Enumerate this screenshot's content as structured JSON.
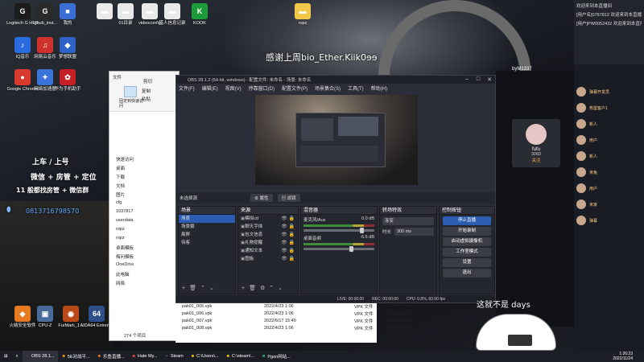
{
  "desktop": {
    "icons": [
      {
        "label": "Logitech G HUB",
        "color": "#1b1b1b",
        "glyph": "G"
      },
      {
        "label": "Ighub_inst...",
        "color": "#2a2a2a",
        "glyph": "G"
      },
      {
        "label": "我的",
        "color": "#3b6fd6",
        "glyph": "■"
      },
      {
        "label": "",
        "color": "#e9e9e9",
        "glyph": "▬"
      },
      {
        "label": "01目录",
        "color": "#e9e9e9",
        "glyph": "▬"
      },
      {
        "label": "videoconfig",
        "color": "#e9e9e9",
        "glyph": "▬"
      },
      {
        "label": "猎人信息记录",
        "color": "#e9e9e9",
        "glyph": "▬"
      },
      {
        "label": "KOOK",
        "color": "#1d9b3a",
        "glyph": "K"
      },
      {
        "label": "ropz",
        "color": "#f2c84b",
        "glyph": "▬"
      },
      {
        "label": "IQ音乐",
        "color": "#2b6be0",
        "glyph": "♪"
      },
      {
        "label": "网易云音乐",
        "color": "#d0312d",
        "glyph": "♫"
      },
      {
        "label": "梦想联盟",
        "color": "#2e62c6",
        "glyph": "◆"
      },
      {
        "label": "Google Chrome",
        "color": "#d93a2f",
        "glyph": "●"
      },
      {
        "label": "网络加速器",
        "color": "#3a74d8",
        "glyph": "✦"
      },
      {
        "label": "华为手机助手",
        "color": "#c61f26",
        "glyph": "✿"
      },
      {
        "label": "火绒安全软件",
        "color": "#e57a21",
        "glyph": "◆"
      },
      {
        "label": "CPU-Z",
        "color": "#4a6a9a",
        "glyph": "▣"
      },
      {
        "label": "FurMark_1...",
        "color": "#b84a1a",
        "glyph": "◉"
      },
      {
        "label": "AIDA64 Extreme",
        "color": "#2f4f8a",
        "glyph": "64"
      },
      {
        "label": "此电脑",
        "color": "#3c7ed1",
        "glyph": "▭"
      },
      {
        "label": "ropz",
        "color": "#f2c84b",
        "glyph": "▬"
      },
      {
        "label": "卡点视频截图",
        "color": "#e0c45a",
        "glyph": "▬"
      },
      {
        "label": "卡点视频截图",
        "color": "#e9e9e9",
        "glyph": "▬"
      },
      {
        "label": "GameBuff",
        "color": "#c35a1a",
        "glyph": "◆"
      },
      {
        "label": "新建文本文档",
        "color": "#e9e9e9",
        "glyph": "▬"
      },
      {
        "label": "KaiHeiLa",
        "color": "#e9e9e9",
        "glyph": "▬"
      },
      {
        "label": "开播",
        "color": "#e9e9e9",
        "glyph": "▬"
      }
    ]
  },
  "overlay": {
    "thanks_text": "感谢上周bio_Ether.Kiik0ɘɘ",
    "promo_line1": "上车 / 上号",
    "promo_line2": "微信 + 房管 + 定位",
    "promo_line3": "11 般都找房管 + 微信群",
    "qq_number": "0813716798570",
    "caption": "这就不是 days"
  },
  "explorer": {
    "ribbon_items": [
      "文件",
      "固定到快速访问",
      "复制",
      "粘贴",
      "剪切"
    ],
    "nav": [
      "快速访问",
      "桌面",
      "下载",
      "文档",
      "图片",
      "cfg",
      "1037817",
      "userdata",
      "ropz",
      "ropz",
      "卓面模板",
      "梅问模板",
      "OneDrive",
      "此电脑",
      "网络"
    ],
    "status": "274 个项目"
  },
  "files": {
    "rows": [
      {
        "name": "pak01_005.vpk",
        "date": "2022/4/23 1:06",
        "type": "VPK 文件",
        "size": "107,540 KB"
      },
      {
        "name": "pak01_006.vpk",
        "date": "2022/4/23 1:06",
        "type": "VPK 文件",
        "size": "130,506 KB"
      },
      {
        "name": "pak01_007.vpk",
        "date": "2022/6/17 15:40",
        "type": "VPK 文件",
        "size": "141,644 KB"
      },
      {
        "name": "pak01_008.vpk",
        "date": "2022/4/23 1:06",
        "type": "VPK 文件",
        "size": "139,020 KB"
      }
    ]
  },
  "obs": {
    "title": "OBS 28.1.2 (64-bit, windows) - 配置文件: 未命名 - 场景: 未命名",
    "menu": [
      "文件(F)",
      "编辑(E)",
      "视图(V)",
      "停靠窗口(D)",
      "配置文件(P)",
      "场景集合(S)",
      "工具(T)",
      "帮助(H)"
    ],
    "source_label": "未选择源",
    "props_button": "属性",
    "filters_button": "滤镜",
    "scenes": {
      "header": "场景",
      "items": [
        "场景",
        "场景摄",
        "离屏",
        "待客"
      ]
    },
    "sources": {
      "header": "来源",
      "items": [
        "模拟cd",
        "聊天字体",
        "包文信息",
        "礼物提醒",
        "通知文本",
        "图板"
      ]
    },
    "mixer": {
      "header": "混音器",
      "tracks": [
        {
          "name": "麦克风/Aux",
          "db": "0.0 dB"
        },
        {
          "name": "桌面音频",
          "db": "-6.5 dB"
        }
      ]
    },
    "transitions": {
      "header": "转场特效",
      "type": "渐变",
      "duration_label": "时长",
      "duration": "300 ms"
    },
    "controls": {
      "header": "控制按钮",
      "buttons": [
        "停止直播",
        "开始录制",
        "启动虚拟摄像机",
        "工作室模式",
        "设置",
        "退出"
      ]
    },
    "status": {
      "live": "LIVE: 00:00:00",
      "rec": "REC: 00:00:00",
      "cpu": "CPU: 0.8%, 60.00 fps"
    }
  },
  "stream": {
    "username": "byM1337",
    "follower_name": "fufu",
    "follower_count": "3060",
    "follower_note": "关注"
  },
  "chat": {
    "lines": [
      "欢迎来到本直播间",
      "[用户名]0787812 欢迎来到本直播间",
      "[用户]PW0052432 欢迎来到本直播间"
    ],
    "avatars": [
      "弹幕开发员",
      "热鉴客户1",
      "新人",
      "用户",
      "新人",
      "米兔",
      "用户",
      "米家",
      "弹幕"
    ]
  },
  "taskbar": {
    "items": [
      "OBS 28.1...",
      "5E对战平...",
      "乐鱼直播...",
      "Hate My...",
      "Steam",
      "C:\\Users\\...",
      "C:\\steam\\...",
      "Pgon网站..."
    ],
    "time": "1:26:23",
    "date": "2022/11/24"
  }
}
